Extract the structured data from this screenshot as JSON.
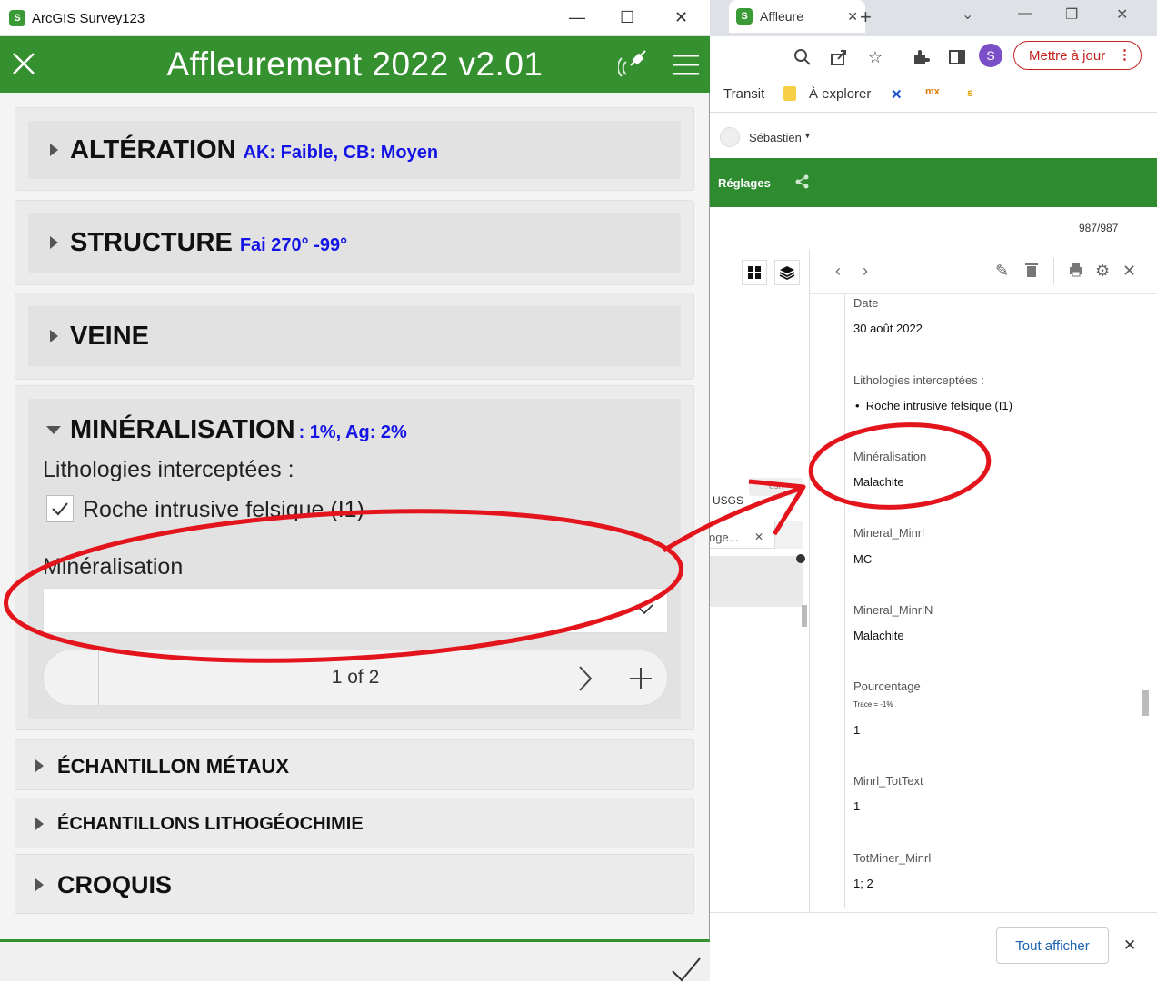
{
  "browser": {
    "tab_title": "Affleure",
    "update_button": "Mettre à jour",
    "profile_initial": "S",
    "bookmarks": [
      "Transit",
      "À explorer"
    ],
    "user_name": "Sébastien",
    "settings_label": "Réglages",
    "record_count": "987/987",
    "map_attribution": "USGS",
    "layer_partial": "oge...",
    "show_all_button": "Tout afficher"
  },
  "details": {
    "fields": [
      {
        "label": "Date",
        "value": "30 août 2022"
      },
      {
        "label": "Lithologies interceptées :",
        "value": "Roche intrusive felsique (I1)"
      },
      {
        "label": "Minéralisation",
        "value": "Malachite"
      },
      {
        "label": "Mineral_Minrl",
        "value": "MC"
      },
      {
        "label": "Mineral_MinrlN",
        "value": "Malachite"
      },
      {
        "label": "Pourcentage",
        "note": "Trace = -1%",
        "value": "1"
      },
      {
        "label": "Minrl_TotText",
        "value": "1"
      },
      {
        "label": "TotMiner_Minrl",
        "value": "1; 2"
      }
    ]
  },
  "survey": {
    "window_title": "ArcGIS Survey123",
    "form_title": "Affleurement 2022 v2.01",
    "groups": [
      {
        "title": "ALTÉRATION",
        "subtitle": "AK: Faible, CB: Moyen"
      },
      {
        "title": "STRUCTURE",
        "subtitle": "Fai 270° -99°"
      },
      {
        "title": "VEINE",
        "subtitle": ""
      },
      {
        "title": "MINÉRALISATION",
        "subtitle": ": 1%, Ag: 2%"
      },
      {
        "title": "ÉCHANTILLON MÉTAUX"
      },
      {
        "title": "ÉCHANTILLONS LITHOGÉOCHIMIE"
      },
      {
        "title": "CROQUIS"
      }
    ],
    "mineral": {
      "lithologies_label": "Lithologies interceptées :",
      "checkbox_label": "Roche intrusive felsique (I1)",
      "mineralisation_label": "Minéralisation",
      "select_value": "",
      "pager_text": "1 of 2"
    }
  },
  "colors": {
    "header_green": "#35902f",
    "subtitle_blue": "#1414e6",
    "annotation_red": "#e3141b"
  }
}
